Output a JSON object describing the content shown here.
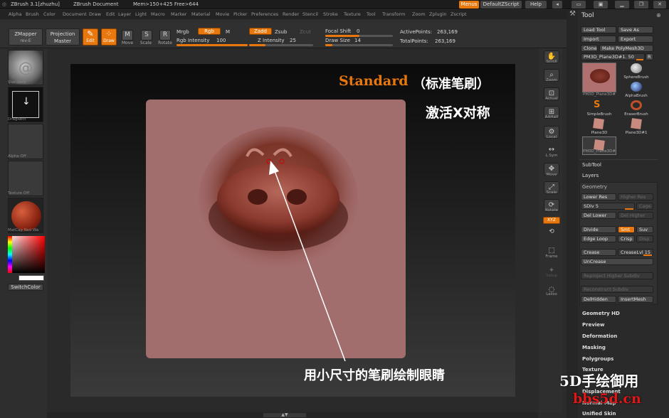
{
  "titlebar": {
    "app": "ZBrush 3.1[zhuzhu]",
    "doc": "ZBrush Document",
    "mem": "Mem>150+425 Free>644",
    "menus_btn": "Menus",
    "script_btn": "DefaultZScript",
    "help_btn": "Help"
  },
  "menubar": [
    "Alpha",
    "Brush",
    "Color",
    "Document",
    "Draw",
    "Edit",
    "Layer",
    "Light",
    "Macro",
    "Marker",
    "Material",
    "Movie",
    "Picker",
    "Preferences",
    "Render",
    "Stencil",
    "Stroke",
    "Texture",
    "Tool",
    "Transform",
    "Zoom",
    "Zplugin",
    "Zscript"
  ],
  "toolbar": {
    "zmapper": "ZMapper",
    "zmapper_sub": "rev-E",
    "projection": "Projection",
    "projection_sub": "Master",
    "edit": "Edit",
    "draw": "Draw",
    "move": "Move",
    "scale": "Scale",
    "rotate": "Rotate",
    "mrgb": "Mrgb",
    "rgb": "Rgb",
    "m": "M",
    "rgb_intensity_label": "Rgb Intensity",
    "rgb_intensity": "100",
    "rgb_intensity_level": 1.0,
    "zadd": "Zadd",
    "zsub": "Zsub",
    "zcut": "Zcut",
    "z_intensity_label": "Z Intensity",
    "z_intensity": "25",
    "z_intensity_level": 0.25,
    "focal_shift_label": "Focal Shift",
    "focal_shift": "0",
    "focal_shift_level": 0.5,
    "draw_size_label": "Draw Size",
    "draw_size": "14",
    "draw_size_level": 0.1,
    "active_points_label": "ActivePoints:",
    "active_points": "263,169",
    "total_points_label": "TotalPoints:",
    "total_points": "263,169"
  },
  "leftshelf": {
    "standard": "Standard",
    "dragrect": "DragRect",
    "alpha": "Alpha  Off",
    "texture": "Texture  Off",
    "matcap": "MatCap  Red  Wa",
    "switchcolor": "SwitchColor"
  },
  "rightshelf": [
    "Scroll",
    "Zoom",
    "Actual",
    "AAHalf",
    "Local",
    "L.Sym",
    "Move",
    "Scale",
    "Rotate",
    "XYZ",
    "",
    "Frame",
    "Setup",
    "Lasso"
  ],
  "panel": {
    "title": "Tool",
    "load_tool": "Load Tool",
    "save_as": "Save As",
    "import": "Import",
    "export": "Export",
    "clone": "Clone",
    "make_polymesh": "Make PolyMesh3D",
    "current_tool": "PM3D_Plane3D#1. 50",
    "r": "R",
    "tools": [
      "PM3D_Plane3D#",
      "SphereBrush",
      "AlphaBrush",
      "SimpleBrush",
      "EraserBrush",
      "Plane3D",
      "Plane3D#1",
      "PM3D_Plane3D#"
    ],
    "subtool": "SubTool",
    "layers": "Layers",
    "geometry": "Geometry",
    "lower_res": "Lower Res",
    "higher_res": "Higher Res",
    "sdiv": "SDiv 5",
    "cage": "Cage",
    "del_lower": "Del Lower",
    "del_higher": "Del Higher",
    "divide": "Divide",
    "smt": "Smt",
    "suv": "Suv",
    "edge_loop": "Edge Loop",
    "crisp": "Crisp",
    "disp": "Disp",
    "crease": "Crease",
    "crease_lvl": "CreaseLvl 15",
    "uncrease": "UnCrease",
    "reproject": "Reproject Higher Subdiv",
    "reconstruct": "Reconstruct Subdiv",
    "delhidden": "DelHidden",
    "insertmesh": "InsertMesh",
    "sections": [
      "Geometry HD",
      "Preview",
      "Deformation",
      "Masking",
      "Polygroups",
      "Texture",
      "Displacement",
      "Normal Map",
      "Unified Skin"
    ]
  },
  "overlay": {
    "title_en": "Standard",
    "title_cn": "（标准笔刷）",
    "subtitle": "激活X对称",
    "caption": "用小尺寸的笔刷绘制眼睛",
    "wm_cn": "5D手绘御用",
    "wm_url": "bbs5d.cn"
  },
  "colors": {
    "accent": "#e8780d",
    "canvas": "#a26d6d"
  }
}
